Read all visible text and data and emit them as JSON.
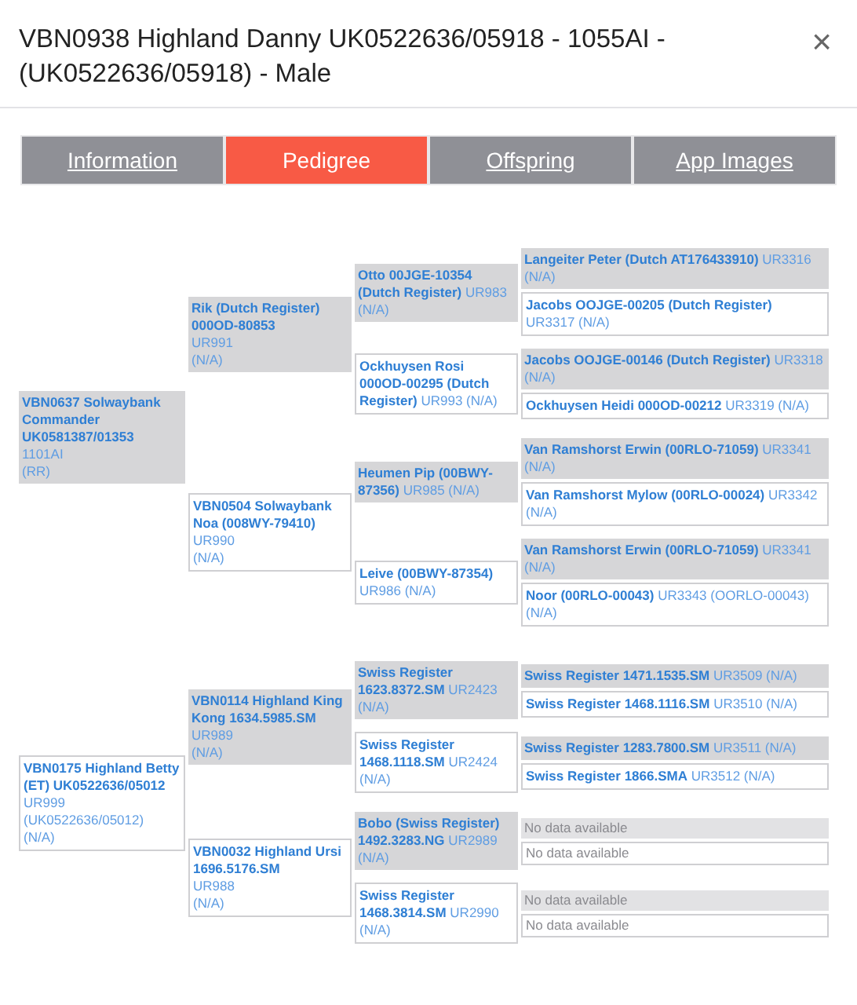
{
  "title": "VBN0938 Highland Danny UK0522636/05918 - 1055AI - (UK0522636/05918) - Male",
  "close": "×",
  "tabs": [
    {
      "label": "Information",
      "selected": false
    },
    {
      "label": "Pedigree",
      "selected": true
    },
    {
      "label": "Offspring",
      "selected": false
    },
    {
      "label": "App Images",
      "selected": false
    }
  ],
  "pedigree": {
    "children": [
      {
        "kind": "sire",
        "name": "VBN0637 Solwaybank Commander UK0581387/01353",
        "info": [
          "1101AI",
          "(RR)"
        ],
        "children": [
          {
            "kind": "sire",
            "name": "Rik (Dutch Register) 000OD-80853",
            "info": [
              "UR991",
              "(N/A)"
            ],
            "children": [
              {
                "kind": "sire",
                "name": "Otto 00JGE-10354 (Dutch Register)",
                "info": [
                  "UR983",
                  "(N/A)"
                ],
                "children": [
                  {
                    "kind": "sire",
                    "name": "Langeiter Peter (Dutch AT176433910)",
                    "info": [
                      "UR3316",
                      "(N/A)"
                    ]
                  },
                  {
                    "kind": "dam",
                    "name": "Jacobs OOJGE-00205 (Dutch Register)",
                    "info": [
                      "UR3317",
                      "(N/A)"
                    ]
                  }
                ]
              },
              {
                "kind": "dam",
                "name": "Ockhuysen Rosi 000OD-00295 (Dutch Register)",
                "info": [
                  "UR993",
                  "(N/A)"
                ],
                "children": [
                  {
                    "kind": "sire",
                    "name": "Jacobs OOJGE-00146 (Dutch Register)",
                    "info": [
                      "UR3318",
                      "(N/A)"
                    ]
                  },
                  {
                    "kind": "dam",
                    "name": "Ockhuysen Heidi 000OD-00212",
                    "info": [
                      "UR3319",
                      "(N/A)"
                    ]
                  }
                ]
              }
            ]
          },
          {
            "kind": "dam",
            "name": "VBN0504 Solwaybank Noa (008WY-79410)",
            "info": [
              "UR990",
              "(N/A)"
            ],
            "children": [
              {
                "kind": "sire",
                "name": "Heumen Pip (00BWY-87356)",
                "info": [
                  "UR985",
                  "(N/A)"
                ],
                "children": [
                  {
                    "kind": "sire",
                    "name": "Van Ramshorst Erwin (00RLO-71059)",
                    "info": [
                      "UR3341",
                      "(N/A)"
                    ]
                  },
                  {
                    "kind": "dam",
                    "name": "Van Ramshorst Mylow (00RLO-00024)",
                    "info": [
                      "UR3342",
                      "(N/A)"
                    ]
                  }
                ]
              },
              {
                "kind": "dam",
                "name": "Leive (00BWY-87354)",
                "info": [
                  "UR986",
                  "(N/A)"
                ],
                "children": [
                  {
                    "kind": "sire",
                    "name": "Van Ramshorst Erwin (00RLO-71059)",
                    "info": [
                      "UR3341",
                      "(N/A)"
                    ]
                  },
                  {
                    "kind": "dam",
                    "name": "Noor (00RLO-00043)",
                    "info": [
                      "UR3343",
                      "(OORLO-00043)",
                      "(N/A)"
                    ]
                  }
                ]
              }
            ]
          }
        ]
      },
      {
        "kind": "dam",
        "name": "VBN0175 Highland Betty (ET) UK0522636/05012",
        "info": [
          "UR999",
          "(UK0522636/05012)",
          "(N/A)"
        ],
        "children": [
          {
            "kind": "sire",
            "name": "VBN0114 Highland King Kong 1634.5985.SM",
            "info": [
              "UR989",
              "(N/A)"
            ],
            "children": [
              {
                "kind": "sire",
                "name": "Swiss Register 1623.8372.SM",
                "info": [
                  "UR2423",
                  "(N/A)"
                ],
                "children": [
                  {
                    "kind": "sire",
                    "name": "Swiss Register 1471.1535.SM",
                    "info": [
                      "UR3509",
                      "(N/A)"
                    ]
                  },
                  {
                    "kind": "dam",
                    "name": "Swiss Register 1468.1116.SM",
                    "info": [
                      "UR3510",
                      "(N/A)"
                    ]
                  }
                ]
              },
              {
                "kind": "dam",
                "name": "Swiss Register 1468.1118.SM",
                "info": [
                  "UR2424",
                  "(N/A)"
                ],
                "children": [
                  {
                    "kind": "sire",
                    "name": "Swiss Register 1283.7800.SM",
                    "info": [
                      "UR3511",
                      "(N/A)"
                    ]
                  },
                  {
                    "kind": "dam",
                    "name": "Swiss Register 1866.SMA",
                    "info": [
                      "UR3512",
                      "(N/A)"
                    ]
                  }
                ]
              }
            ]
          },
          {
            "kind": "dam",
            "name": "VBN0032 Highland Ursi 1696.5176.SM",
            "info": [
              "UR988",
              "(N/A)"
            ],
            "children": [
              {
                "kind": "sire",
                "name": "Bobo (Swiss Register) 1492.3283.NG",
                "info": [
                  "UR2989",
                  "(N/A)"
                ],
                "children": [
                  {
                    "kind": "sire",
                    "no_data": true,
                    "name": "No data available"
                  },
                  {
                    "kind": "dam",
                    "no_data": true,
                    "name": "No data available"
                  }
                ]
              },
              {
                "kind": "dam",
                "name": "Swiss Register 1468.3814.SM",
                "info": [
                  "UR2990",
                  "(N/A)"
                ],
                "children": [
                  {
                    "kind": "sire",
                    "no_data": true,
                    "name": "No data available"
                  },
                  {
                    "kind": "dam",
                    "no_data": true,
                    "name": "No data available"
                  }
                ]
              }
            ]
          }
        ]
      }
    ]
  }
}
